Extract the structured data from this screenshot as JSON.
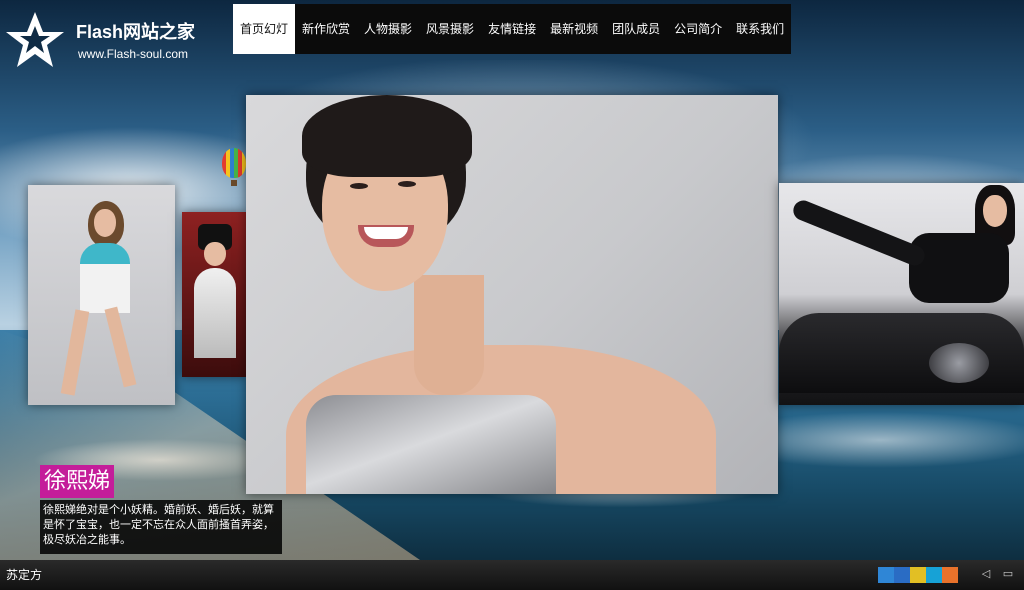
{
  "header": {
    "site_name": "Flash网站之家",
    "site_url": "www.Flash-soul.com"
  },
  "nav": {
    "items": [
      {
        "label": "首页幻灯",
        "active": true
      },
      {
        "label": "新作欣赏"
      },
      {
        "label": "人物摄影"
      },
      {
        "label": "风景摄影"
      },
      {
        "label": "友情链接"
      },
      {
        "label": "最新视频"
      },
      {
        "label": "团队成员"
      },
      {
        "label": "公司简介"
      },
      {
        "label": "联系我们"
      }
    ]
  },
  "slideshow": {
    "caption_title": "徐熙娣",
    "caption_text": "徐熙娣绝对是个小妖精。婚前妖、婚后妖，就算是怀了宝宝，也一定不忘在众人面前搔首弄姿，极尽妖冶之能事。"
  },
  "player": {
    "track_name": "苏定方"
  },
  "icons": {
    "logo": "star-logo-icon",
    "share": [
      "qq-zone-icon",
      "renren-icon",
      "kaixin-icon",
      "qq-weibo-icon",
      "sina-weibo-icon"
    ],
    "prev": "speaker-icon",
    "screen": "fullscreen-icon"
  },
  "colors": {
    "nav_bg": "#0b0b0b",
    "nav_active_bg": "#ffffff",
    "caption_title_bg": "#c41d9a",
    "bottom_bar_bg": "#111111"
  }
}
